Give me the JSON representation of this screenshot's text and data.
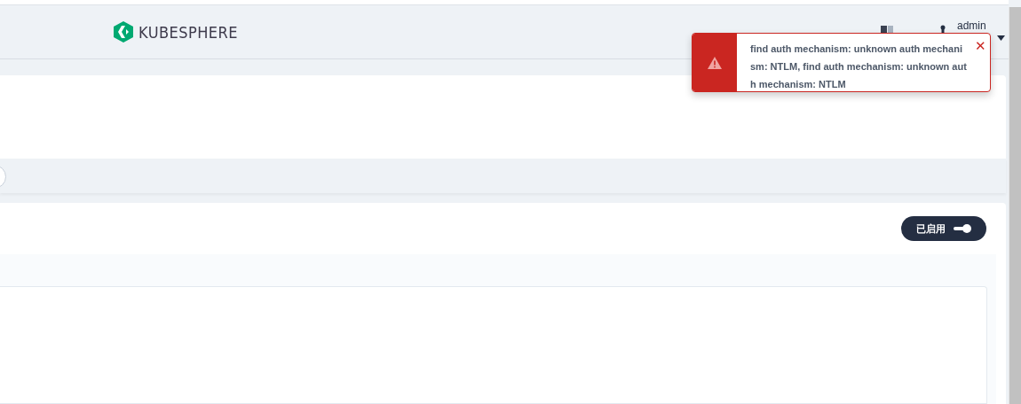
{
  "header": {
    "logo_text": "KUBESPHERE",
    "user": "admin"
  },
  "toast": {
    "message": "find auth mechanism: unknown auth mechanism: NTLM, find auth mechanism: unknown auth mechanism: NTLM",
    "close": "✕"
  },
  "status_button": {
    "label": "已启用",
    "on": true
  }
}
